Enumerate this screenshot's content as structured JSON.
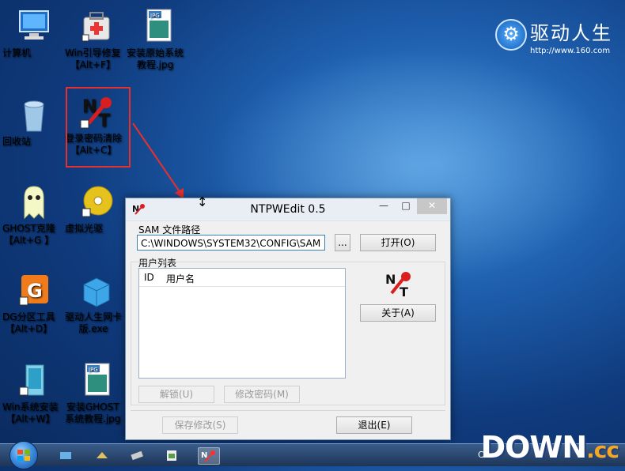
{
  "desktop": {
    "icons": [
      {
        "label": "计算机"
      },
      {
        "label": "Win引导修复\n【Alt+F】"
      },
      {
        "label": "安装原始系统\n教程.jpg"
      },
      {
        "label": "回收站"
      },
      {
        "label": "登录密码清除\n【Alt+C】"
      },
      {
        "label": "GHOST克隆\n【Alt+G 】"
      },
      {
        "label": "虚拟光驱"
      },
      {
        "label": "DG分区工具\n【Alt+D】"
      },
      {
        "label": "驱动人生网卡\n版.exe"
      },
      {
        "label": "Win系统安装\n【Alt+W】"
      },
      {
        "label": "安装GHOST\n系统教程.jpg"
      }
    ],
    "brand": {
      "name": "驱动人生",
      "url": "http://www.160.com"
    }
  },
  "window": {
    "title": "NTPWEdit 0.5",
    "sam_label": "SAM 文件路径",
    "sam_path": "C:\\WINDOWS\\SYSTEM32\\CONFIG\\SAM",
    "browse_label": "...",
    "open_label": "打开(O)",
    "user_list_label": "用户列表",
    "columns": [
      "ID",
      "用户名"
    ],
    "about_label": "关于(A)",
    "unlock_label": "解锁(U)",
    "change_pwd_label": "修改密码(M)",
    "save_label": "保存修改(S)",
    "exit_label": "退出(E)"
  },
  "taskbar": {
    "tray_text": "CH"
  },
  "watermark": {
    "main": "DOWN",
    "suffix": ".cc"
  }
}
